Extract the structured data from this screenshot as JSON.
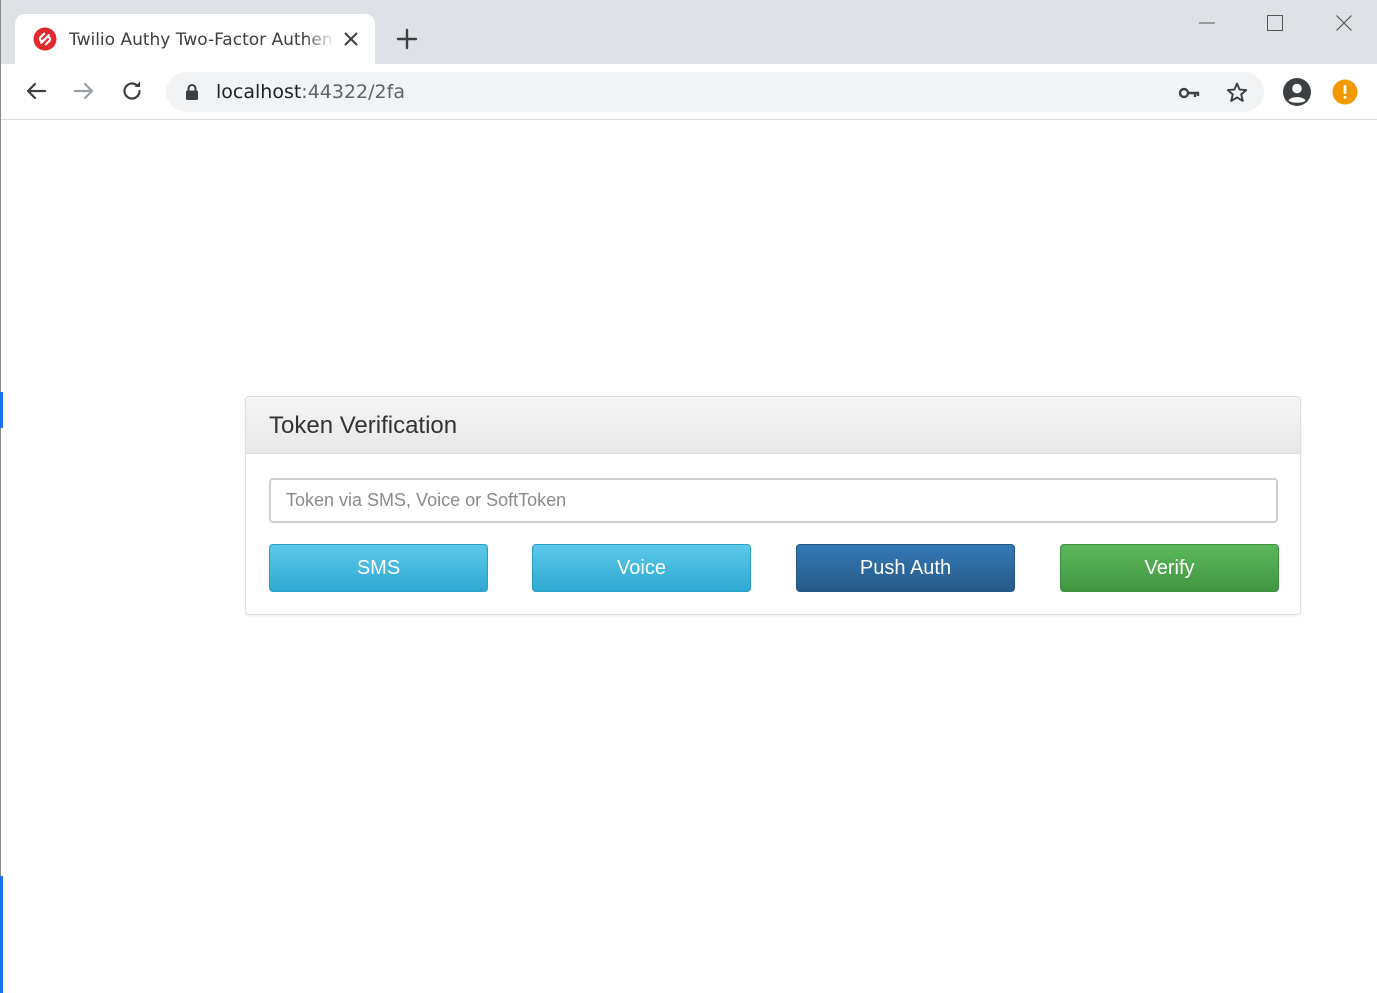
{
  "browser": {
    "tab": {
      "title": "Twilio Authy Two-Factor Authentication",
      "favicon": "authy-icon",
      "favicon_color": "#e2282c"
    },
    "icons": {
      "new_tab": "plus-icon",
      "minimize": "minimize-icon",
      "maximize": "maximize-icon",
      "close": "close-icon",
      "back": "arrow-left-icon",
      "forward": "arrow-right-icon",
      "reload": "reload-icon",
      "lock": "lock-icon",
      "key": "key-icon",
      "bookmark": "star-icon",
      "profile": "account-circle-icon",
      "alert": "alert-icon"
    },
    "address_bar": {
      "host": "localhost",
      "rest": ":44322/2fa"
    },
    "alert_color": "#f29900"
  },
  "page": {
    "panel": {
      "title": "Token Verification"
    },
    "token_input": {
      "value": "",
      "placeholder": "Token via SMS, Voice or SoftToken"
    },
    "buttons": {
      "sms": "SMS",
      "voice": "Voice",
      "push_auth": "Push Auth",
      "verify": "Verify"
    },
    "colors": {
      "info": "#31b0d5",
      "primary": "#286090",
      "success": "#449d44"
    }
  }
}
